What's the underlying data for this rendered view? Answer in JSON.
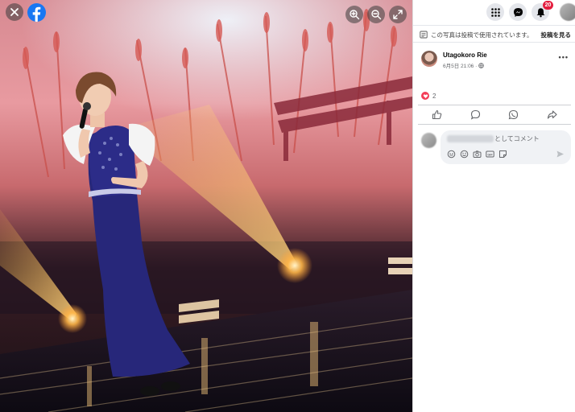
{
  "viewer": {
    "close_icon": "close-icon",
    "logo_icon": "facebook-logo",
    "controls": [
      "zoom-in-icon",
      "zoom-out-icon",
      "fullscreen-icon"
    ]
  },
  "header": {
    "menu_icon": "grid-menu-icon",
    "messenger_icon": "messenger-icon",
    "notifications_icon": "bell-icon",
    "notification_count": "20"
  },
  "usage_notice": {
    "text": "この写真は投稿で使用されています。",
    "link_label": "投稿を見る"
  },
  "post": {
    "author": "Utagokoro Rie",
    "date": "6月5日 21:06 ·",
    "privacy_icon": "globe-icon",
    "more_label": "•••",
    "reaction_count": "2"
  },
  "actions": [
    "like-icon",
    "comment-icon",
    "whatsapp-icon",
    "share-icon"
  ],
  "comment": {
    "placeholder_suffix": "としてコメント",
    "icons": [
      "avatar-sticker-icon",
      "emoji-icon",
      "camera-icon",
      "gif-icon",
      "sticker-icon"
    ],
    "send_icon": "send-icon"
  },
  "colors": {
    "accent": "#1877f2",
    "badge": "#e41e3f",
    "heart": "#f33e58",
    "dress": "#27277a"
  }
}
